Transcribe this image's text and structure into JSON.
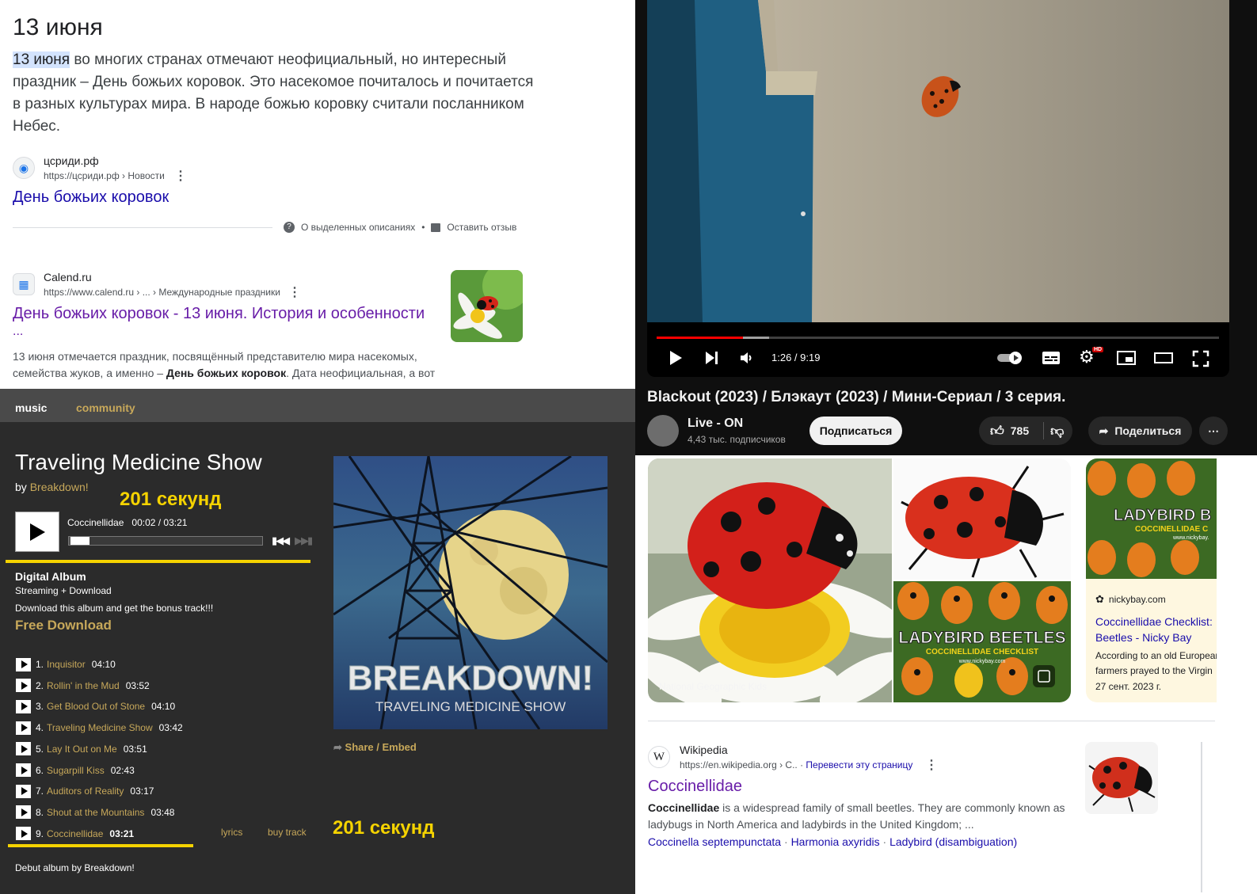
{
  "search_top": {
    "date_heading": "13 июня",
    "snippet_highlight": "13 июня",
    "snippet_rest": " во многих странах отмечают неофициальный, но интересный праздник – День божьих коровок. Это насекомое почиталось и почитается в разных культурах мира. В народе божью коровку считали посланником Небес.",
    "result1": {
      "site": "цсриди.рф",
      "url": "https://цсриди.рф › Новости",
      "title": "День божьих коровок"
    },
    "feedback_about": "О выделенных описаниях",
    "feedback_bullet": "•",
    "feedback_leave": "Оставить отзыв",
    "result2": {
      "site": "Calend.ru",
      "url": "https://www.calend.ru › ... › Международные праздники",
      "title": "День божьих коровок - 13 июня. История и особенности",
      "title_cont": "...",
      "desc_pre": "13 июня отмечается праздник, посвящённый представителю мира насекомых, семейства жуков, а именно – ",
      "desc_bold": "День божьих коровок",
      "desc_post": ". Дата неофициальная, а вот"
    }
  },
  "video": {
    "time": "1:26 / 9:19",
    "progress": 0.154,
    "buffered": 0.2,
    "hd_badge": "HD",
    "title": "Blackout (2023) / Блэкаут (2023) / Мини-Сериал / 3 серия.",
    "channel": "Live - ON",
    "subscribers": "4,43 тыс. подписчиков",
    "subscribe": "Подписаться",
    "likes": "785",
    "share": "Поделиться",
    "more": "⋯"
  },
  "bandcamp": {
    "nav": [
      "music",
      "community"
    ],
    "album_title": "Traveling Medicine Show",
    "by": "by",
    "artist": "Breakdown!",
    "annotation": "201 секунд",
    "now_playing": "Coccinellidae",
    "player_time": "00:02 / 03:21",
    "player_progress": 0.01,
    "format": "Digital Album",
    "format_sub": "Streaming + Download",
    "promo": "Download this album and get the bonus track!!!",
    "free_download": "Free Download",
    "tracks": [
      {
        "n": "1.",
        "name": "Inquisitor",
        "time": "04:10"
      },
      {
        "n": "2.",
        "name": "Rollin' in the Mud",
        "time": "03:52"
      },
      {
        "n": "3.",
        "name": "Get Blood Out of Stone",
        "time": "04:10"
      },
      {
        "n": "4.",
        "name": "Traveling Medicine Show",
        "time": "03:42"
      },
      {
        "n": "5.",
        "name": "Lay It Out on Me",
        "time": "03:51"
      },
      {
        "n": "6.",
        "name": "Sugarpill Kiss",
        "time": "02:43"
      },
      {
        "n": "7.",
        "name": "Auditors of Reality",
        "time": "03:17"
      },
      {
        "n": "8.",
        "name": "Shout at the Mountains",
        "time": "03:48"
      },
      {
        "n": "9.",
        "name": "Coccinellidae",
        "time": "03:21"
      }
    ],
    "lyrics": "lyrics",
    "buy_track": "buy track",
    "share_embed": "Share / Embed",
    "cover_band": "BREAKDOWN!",
    "cover_album": "TRAVELING MEDICINE SHOW",
    "debut": "Debut album by Breakdown!"
  },
  "images": {
    "credit_ng": "National Geographic Kids",
    "beetles_title": "LADYBIRD BEETLES",
    "beetles_sub": "COCCINELLIDAE CHECKLIST",
    "beetles_site": "www.nickybay.com",
    "card_title_short": "LADYBIRD B",
    "card_sub_short": "COCCINELLIDAE C",
    "card_site_short": "www.nickybay.",
    "nicky_site": "nickybay.com",
    "nicky_title": "Coccinellidae Checklist: Beetles - Nicky Bay",
    "nicky_desc": "According to an old European farmers prayed to the Virgin",
    "nicky_date": "27 сент. 2023 г."
  },
  "wiki": {
    "site": "Wikipedia",
    "url": "https://en.wikipedia.org › C..",
    "translate": "Перевести эту страницу",
    "title": "Coccinellidae",
    "desc_bold": "Coccinellidae",
    "desc": " is a widespread family of small beetles. They are commonly known as ladybugs in North America and ladybirds in the United Kingdom; ...",
    "links": [
      "Coccinella septempunctata",
      "Harmonia axyridis",
      "Ladybird (disambiguation)"
    ],
    "sep": "·"
  }
}
